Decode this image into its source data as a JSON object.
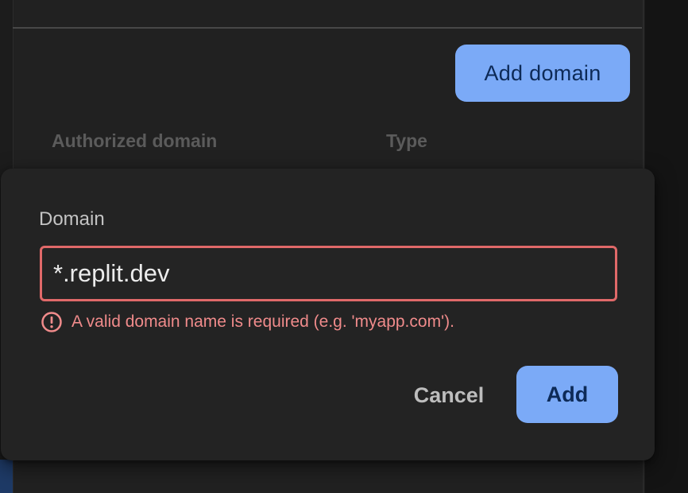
{
  "background": {
    "add_domain_label": "Add domain",
    "columns": [
      "Authorized domain",
      "Type"
    ]
  },
  "dialog": {
    "field_label": "Domain",
    "input_value": "*.replit.dev",
    "error_message": "A valid domain name is required (e.g. 'myapp.com').",
    "cancel_label": "Cancel",
    "add_label": "Add"
  },
  "colors": {
    "accent": "#7baaf7",
    "error": "#e06969",
    "error_text": "#f08b8b"
  },
  "icons": {
    "error": "error-circle-icon"
  }
}
